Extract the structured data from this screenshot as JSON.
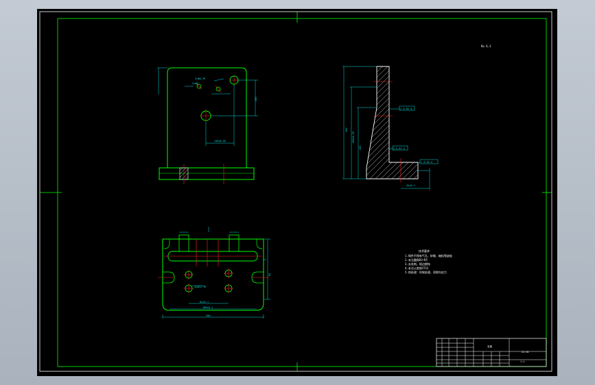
{
  "drawing": {
    "roughness_note": "Ra 6.3",
    "tech_notes": {
      "title": "技术要求",
      "lines": [
        "1.铸件不得有气孔、砂眼、缩松等缺陷",
        "2.未注圆角R3~R5",
        "3.去毛刺，锐边倒钝",
        "4.未注公差按IT12",
        "5.热处理：时效处理，消除内应力"
      ]
    },
    "dimensions": {
      "front_hole_1": "2×Φ8-7H",
      "front_hole_2": "2×Φ6",
      "front_width": "140±0.05",
      "front_height": "100",
      "side_total_height": "190",
      "side_height_2": "160±0.05",
      "side_height_3": "120",
      "side_tol_1": "⊥ 0.02 A",
      "side_tol_2": "∥ 0.02 A",
      "side_tol_3": "⊥ 0.05 A",
      "side_base": "35±0.1",
      "top_width_1": "62±0.1",
      "top_width_2": "180±0.1",
      "top_width_3": "200",
      "top_hole": "4×Φ12-7H",
      "top_depth": "85"
    },
    "title_block": {
      "part_name": "支架",
      "drawing_no": "ZJ-01",
      "scale": "1:1"
    }
  }
}
